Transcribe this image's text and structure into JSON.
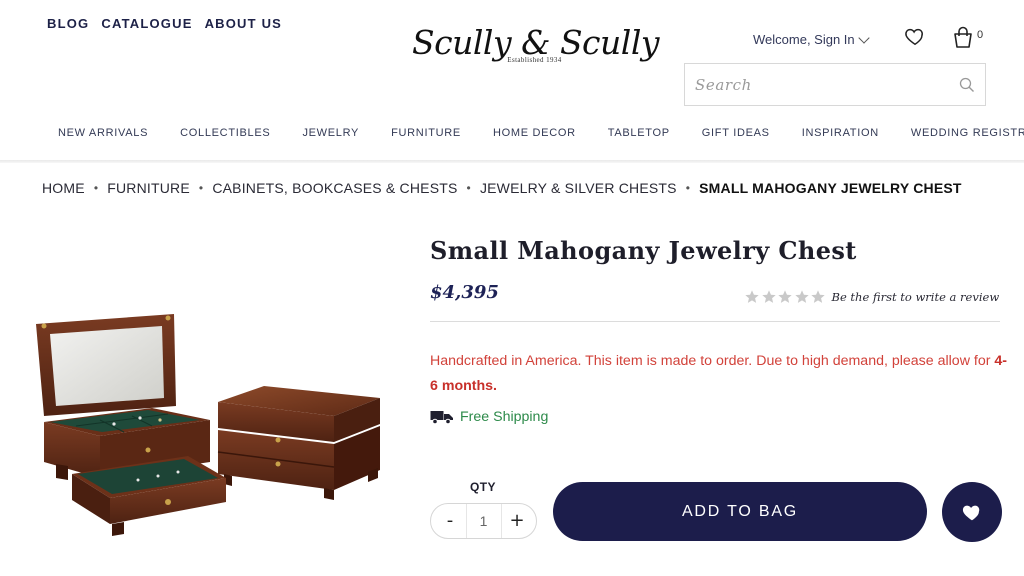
{
  "top_links": [
    "BLOG",
    "CATALOGUE",
    "ABOUT US"
  ],
  "logo": {
    "name": "Scully & Scully",
    "established": "Established 1934"
  },
  "account": {
    "welcome_text": "Welcome, Sign In"
  },
  "cart": {
    "count": "0"
  },
  "search": {
    "placeholder": "Search"
  },
  "nav": [
    "NEW ARRIVALS",
    "COLLECTIBLES",
    "JEWELRY",
    "FURNITURE",
    "HOME DECOR",
    "TABLETOP",
    "GIFT IDEAS",
    "INSPIRATION",
    "WEDDING REGISTRY"
  ],
  "breadcrumb": {
    "items": [
      "HOME",
      "FURNITURE",
      "CABINETS, BOOKCASES & CHESTS",
      "JEWELRY & SILVER CHESTS"
    ],
    "current": "SMALL MAHOGANY JEWELRY CHEST",
    "separator": "•"
  },
  "product": {
    "title": "Small Mahogany Jewelry Chest",
    "price": "$4,395",
    "rating": {
      "stars": 0,
      "max": 5,
      "review_cta": "Be the first to write a review"
    },
    "notice": "Handcrafted in America. This item is made to order. Due to high demand, please allow for",
    "notice_emphasis": "4-6 months.",
    "shipping": "Free Shipping",
    "qty_label": "QTY",
    "qty_value": "1",
    "qty_minus": "-",
    "qty_plus": "+",
    "add_to_bag": "ADD TO BAG"
  },
  "colors": {
    "navy": "#1c1d4b",
    "notice_red": "#d2423a",
    "shipping_green": "#2d8a4a",
    "star_empty": "#c9c9c9"
  },
  "icons": {
    "wishlist": "heart-outline-icon",
    "bag": "shopping-bag-icon",
    "search": "search-icon",
    "shipping": "truck-icon",
    "favorite": "heart-filled-icon"
  }
}
